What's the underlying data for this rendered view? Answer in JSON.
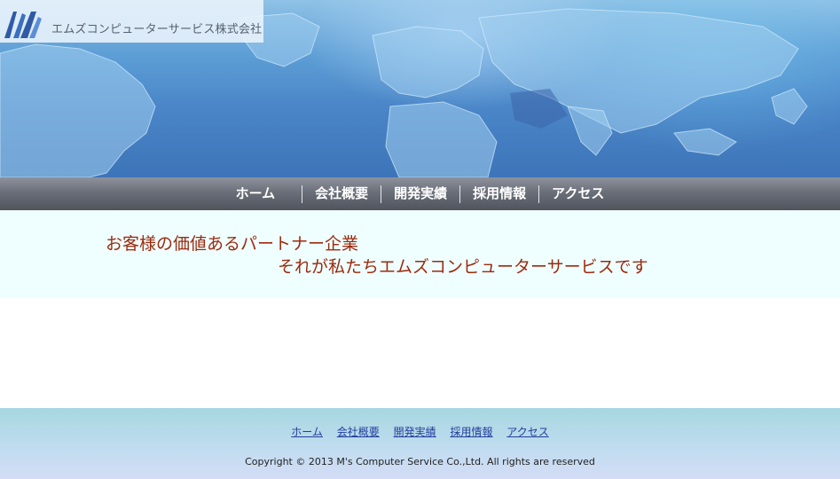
{
  "brand": {
    "company_name": "エムズコンピューターサービス株式会社",
    "logo_icon": "m-logo-icon"
  },
  "nav": {
    "items": [
      {
        "label": "ホーム"
      },
      {
        "label": "会社概要"
      },
      {
        "label": "開発実績"
      },
      {
        "label": "採用情報"
      },
      {
        "label": "アクセス"
      }
    ]
  },
  "hero": {
    "line1": "お客様の価値あるパートナー企業",
    "line2": "それが私たちエムズコンピューターサービスです"
  },
  "footer": {
    "links": [
      {
        "label": "ホーム"
      },
      {
        "label": "会社概要"
      },
      {
        "label": "開発実績"
      },
      {
        "label": "採用情報"
      },
      {
        "label": "アクセス"
      }
    ],
    "copyright": "Copyright © 2013 M's Computer Service Co.,Ltd. All rights are reserved"
  },
  "colors": {
    "banner_blue": "#4a86c8",
    "tagline": "#9c2a0e",
    "link": "#243e9c",
    "hero_bg": "#effefe"
  }
}
